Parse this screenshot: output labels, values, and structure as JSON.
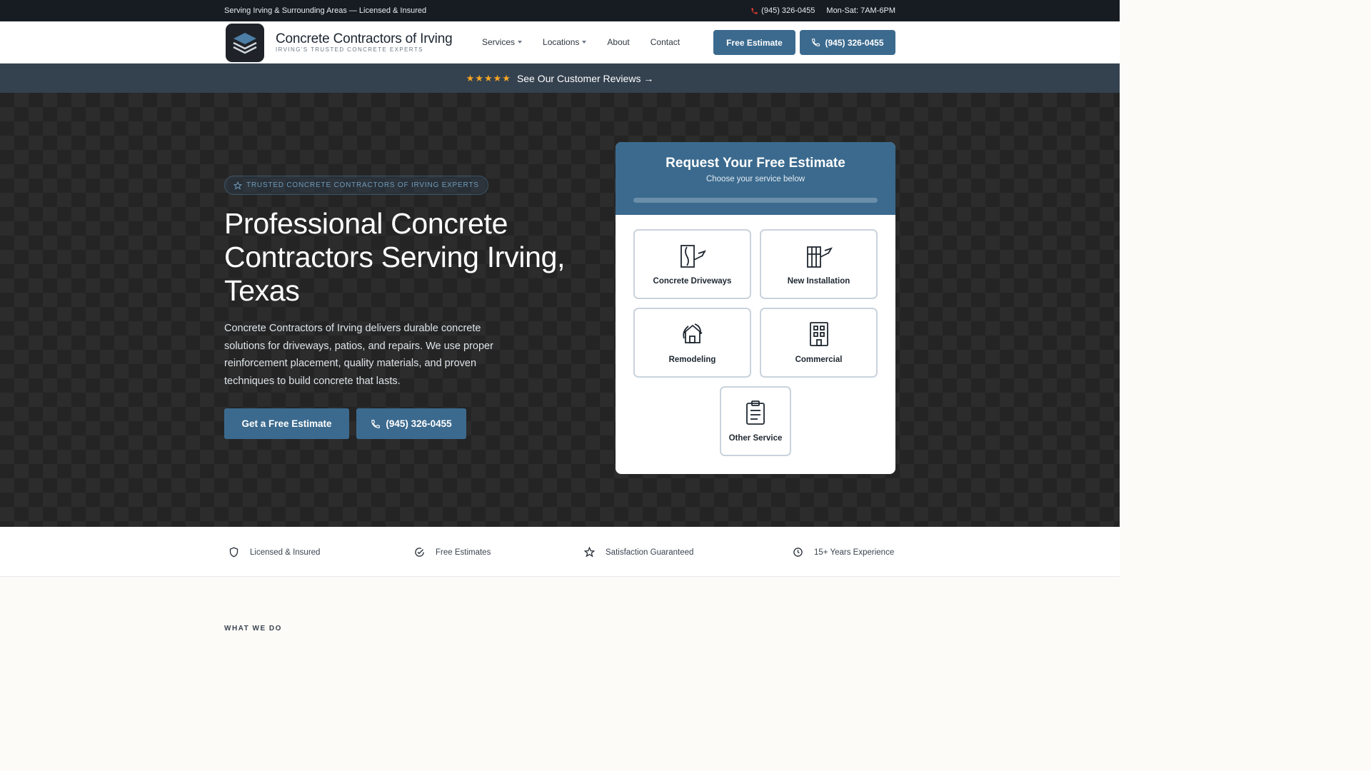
{
  "topbar": {
    "service_area": "Serving Irving & Surrounding Areas — Licensed & Insured",
    "phone": "(945) 326-0455",
    "hours": "Mon-Sat: 7AM-6PM"
  },
  "header": {
    "brand_name": "Concrete Contractors of Irving",
    "brand_tagline": "IRVING'S TRUSTED CONCRETE EXPERTS",
    "nav": [
      {
        "label": "Services",
        "dropdown": true
      },
      {
        "label": "Locations",
        "dropdown": true
      },
      {
        "label": "About",
        "dropdown": false
      },
      {
        "label": "Contact",
        "dropdown": false
      }
    ],
    "estimate_button": "Free Estimate",
    "phone_button": "(945) 326-0455"
  },
  "reviews": {
    "stars": "★★★★★",
    "link_text": "See Our Customer Reviews →"
  },
  "hero": {
    "badge": "TRUSTED CONCRETE CONTRACTORS OF IRVING EXPERTS",
    "title": "Professional Concrete Contractors Serving Irving, Texas",
    "description": "Concrete Contractors of Irving delivers durable concrete solutions for driveways, patios, and repairs. We use proper reinforcement placement, quality materials, and proven techniques to build concrete that lasts.",
    "cta_primary": "Get a Free Estimate",
    "cta_phone": "(945) 326-0455"
  },
  "estimate_card": {
    "title": "Request Your Free Estimate",
    "subtitle": "Choose your service below",
    "progress": 0,
    "options": [
      {
        "label": "Concrete Driveways",
        "icon": "driveway-icon"
      },
      {
        "label": "New Installation",
        "icon": "installation-icon"
      },
      {
        "label": "Remodeling",
        "icon": "house-icon"
      },
      {
        "label": "Commercial",
        "icon": "building-icon"
      },
      {
        "label": "Other Service",
        "icon": "clipboard-icon"
      }
    ]
  },
  "trust": [
    {
      "label": "Licensed & Insured",
      "icon": "shield-icon"
    },
    {
      "label": "Free Estimates",
      "icon": "check-circle-icon"
    },
    {
      "label": "Satisfaction Guaranteed",
      "icon": "star-icon"
    },
    {
      "label": "15+ Years Experience",
      "icon": "clock-icon"
    }
  ],
  "section": {
    "label": "WHAT WE DO"
  },
  "colors": {
    "accent": "#3b6a8e",
    "topbar": "#171c22",
    "reviewbar": "#34414f",
    "star": "#f5a623",
    "phone_icon": "#e03b2f"
  }
}
